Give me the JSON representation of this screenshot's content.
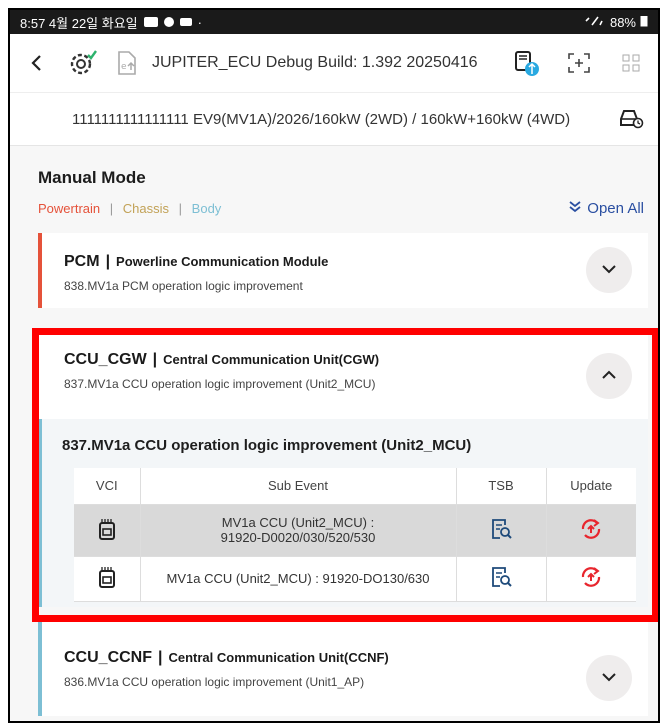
{
  "status_bar": {
    "time_date": "8:57  4월 22일 화요일",
    "battery": "88%",
    "indicators": [
      "cloud-icon",
      "gear-icon",
      "wifi-icon",
      "battery-icon"
    ]
  },
  "app_bar": {
    "title": "JUPITER_ECU Debug Build: 1.392 20250416"
  },
  "vehicle": {
    "info": "1111111111111111  EV9(MV1A)/2026/160kW (2WD) / 160kW+160kW (4WD)"
  },
  "manual_mode": {
    "title": "Manual Mode",
    "categories": [
      "Powertrain",
      "Chassis",
      "Body"
    ],
    "separator": "|",
    "open_all": "Open All"
  },
  "modules": [
    {
      "code": "PCM",
      "name": "Powerline Communication Module",
      "subtitle": "838.MV1a PCM operation logic improvement",
      "accent": "#e5523a",
      "expanded": false
    },
    {
      "code": "CCU_CGW",
      "name": "Central Communication Unit(CGW)",
      "subtitle": "837.MV1a CCU operation logic improvement (Unit2_MCU)",
      "accent": "#7dbfd4",
      "expanded": true,
      "detail_title": "837.MV1a CCU operation logic improvement (Unit2_MCU)",
      "table": {
        "headers": [
          "VCI",
          "Sub Event",
          "TSB",
          "Update"
        ],
        "rows": [
          {
            "sub_event_line1": "MV1a CCU (Unit2_MCU) :",
            "sub_event_line2": "91920-D0020/030/520/530"
          },
          {
            "sub_event_line1": "MV1a CCU (Unit2_MCU) : 91920-DO130/630",
            "sub_event_line2": ""
          }
        ]
      }
    },
    {
      "code": "CCU_CCNF",
      "name": "Central Communication Unit(CCNF)",
      "subtitle": "836.MV1a CCU operation logic improvement (Unit1_AP)",
      "accent": "#7dbfd4",
      "expanded": false
    }
  ],
  "colors": {
    "powertrain": "#e5523a",
    "chassis": "#c2a257",
    "body": "#7dbfd4",
    "update_icon": "#e8262e",
    "highlight": "#ff0000"
  }
}
